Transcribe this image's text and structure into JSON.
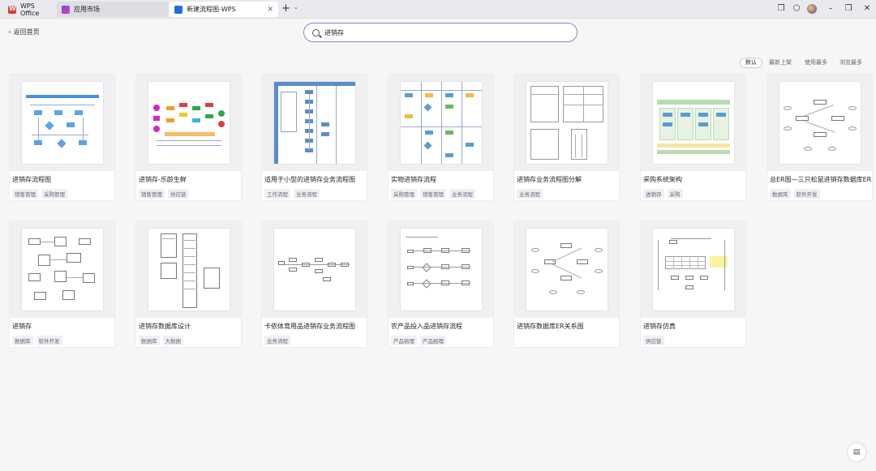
{
  "tabs": [
    {
      "label": "WPS Office"
    },
    {
      "label": "应用市场"
    },
    {
      "label": "新建流程图-WPS"
    }
  ],
  "header": {
    "back_label": "返回首页"
  },
  "search": {
    "value": "进销存"
  },
  "sort": [
    "默认",
    "最新上架",
    "使用最多",
    "浏览最多"
  ],
  "templates": [
    {
      "title": "进销存流程图",
      "tags": [
        "销售管理",
        "采购管理"
      ]
    },
    {
      "title": "进销存-乐龄生鲜",
      "tags": [
        "销售管理",
        "供应链"
      ]
    },
    {
      "title": "适用于小型的进销存业务流程图",
      "tags": [
        "工作流程",
        "业务流程"
      ]
    },
    {
      "title": "实物进销存流程",
      "tags": [
        "采购管理",
        "销售管理",
        "业务流程"
      ]
    },
    {
      "title": "进销存业务流程图分解",
      "tags": [
        "业务流程"
      ]
    },
    {
      "title": "采购系统架构",
      "tags": [
        "进销存",
        "采购"
      ]
    },
    {
      "title": "总ER图—三只松鼠进销存数据库ER...",
      "tags": [
        "数据库",
        "软件开发"
      ]
    },
    {
      "title": "进销存",
      "tags": [
        "数据库",
        "软件开发"
      ]
    },
    {
      "title": "进销存数据库设计",
      "tags": [
        "数据库",
        "大数据"
      ]
    },
    {
      "title": "卡依体育用品进销存业务流程图",
      "tags": [
        "业务流程"
      ]
    },
    {
      "title": "农产品投入品进销存流程",
      "tags": [
        "产品梳理",
        "产品经理"
      ]
    },
    {
      "title": "进销存数据库ER关系图",
      "tags": []
    },
    {
      "title": "进销存仿真",
      "tags": [
        "供应链"
      ]
    }
  ],
  "colors": {
    "accent": "#7d86d8",
    "tab_active": "#ffffff"
  }
}
